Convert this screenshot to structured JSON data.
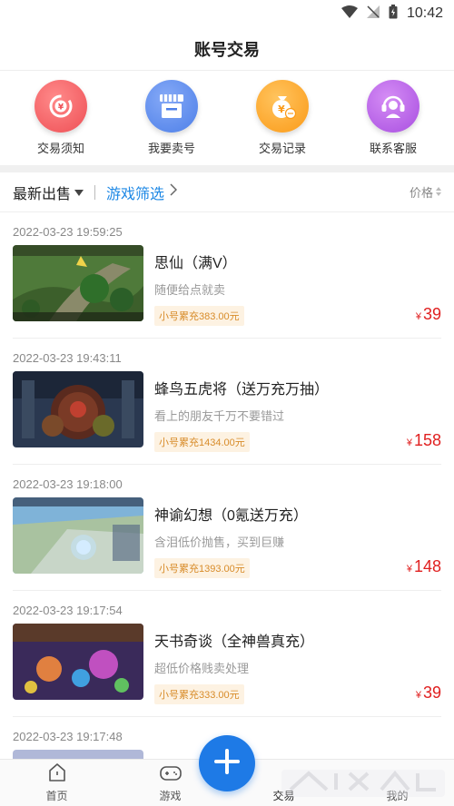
{
  "status_bar": {
    "time": "10:42"
  },
  "header": {
    "title": "账号交易"
  },
  "shortcuts": [
    {
      "label": "交易须知",
      "color": "#f06262"
    },
    {
      "label": "我要卖号",
      "color": "#5b8ff0"
    },
    {
      "label": "交易记录",
      "color": "#ffa92e"
    },
    {
      "label": "联系客服",
      "color": "#b05be8"
    }
  ],
  "filters": {
    "sort_label": "最新出售",
    "game_filter_label": "游戏筛选",
    "price_label": "价格"
  },
  "listings": [
    {
      "time": "2022-03-23 19:59:25",
      "title": "思仙（满V）",
      "desc": "随便给点就卖",
      "recharge": "小号累充383.00元",
      "currency": "¥",
      "price": "39"
    },
    {
      "time": "2022-03-23 19:43:11",
      "title": "蜂鸟五虎将（送万充万抽）",
      "desc": "看上的朋友千万不要错过",
      "recharge": "小号累充1434.00元",
      "currency": "¥",
      "price": "158"
    },
    {
      "time": "2022-03-23 19:18:00",
      "title": "神谕幻想（0氪送万充）",
      "desc": "含泪低价抛售，买到巨赚",
      "recharge": "小号累充1393.00元",
      "currency": "¥",
      "price": "148"
    },
    {
      "time": "2022-03-23 19:17:54",
      "title": "天书奇谈（全神兽真充）",
      "desc": "超低价格贱卖处理",
      "recharge": "小号累充333.00元",
      "currency": "¥",
      "price": "39"
    },
    {
      "time": "2022-03-23 19:17:48"
    }
  ],
  "tabs": [
    {
      "label": "首页"
    },
    {
      "label": "游戏"
    },
    {
      "label": "交易"
    },
    {
      "label": "我的"
    }
  ],
  "colors": {
    "accent": "#1e7ae6",
    "price": "#e02020",
    "recharge_text": "#d88c2a",
    "recharge_bg": "#fdf2e2"
  }
}
